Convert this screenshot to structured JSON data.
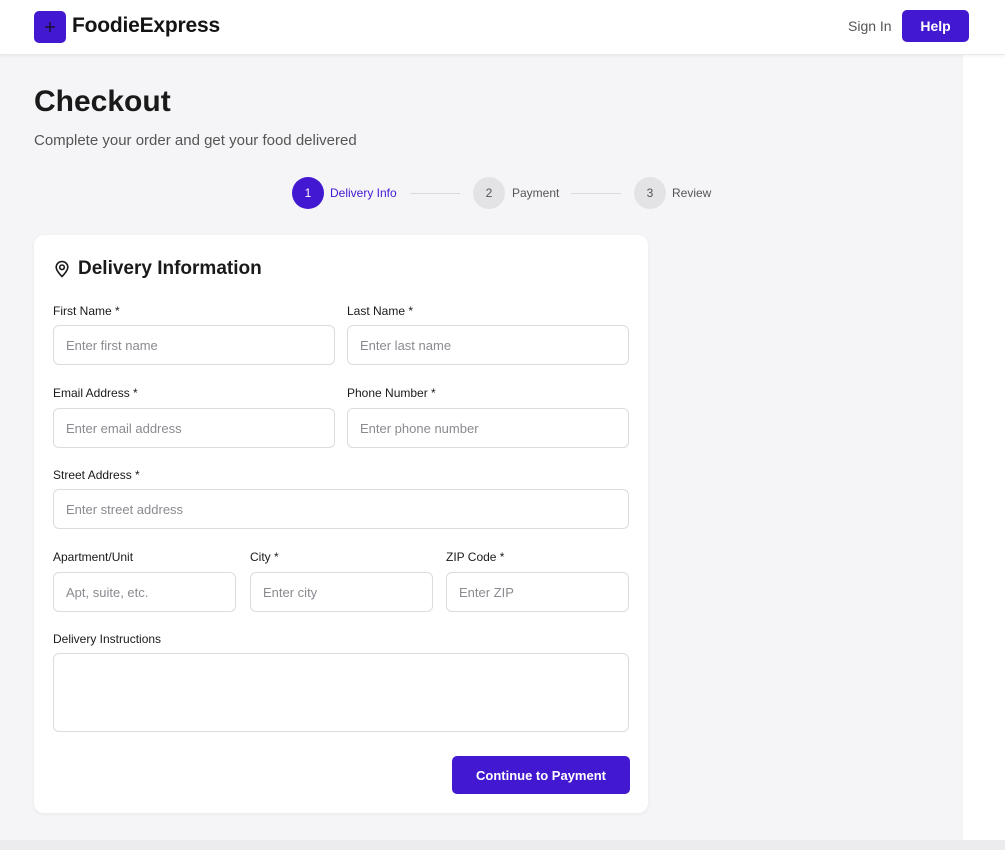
{
  "header": {
    "brand": "FoodieExpress",
    "signin_label": "Sign In",
    "help_label": "Help"
  },
  "page": {
    "title": "Checkout",
    "subtitle": "Complete your order and get your food delivered"
  },
  "steps": [
    {
      "number": "1",
      "label": "Delivery Info",
      "state": "active"
    },
    {
      "number": "2",
      "label": "Payment",
      "state": "inactive"
    },
    {
      "number": "3",
      "label": "Review",
      "state": "inactive"
    }
  ],
  "form": {
    "title": "Delivery Information",
    "first_name": {
      "label": "First Name *",
      "placeholder": "Enter first name",
      "value": ""
    },
    "last_name": {
      "label": "Last Name *",
      "placeholder": "Enter last name",
      "value": ""
    },
    "email": {
      "label": "Email Address *",
      "placeholder": "Enter email address",
      "value": ""
    },
    "phone": {
      "label": "Phone Number *",
      "placeholder": "Enter phone number",
      "value": ""
    },
    "street": {
      "label": "Street Address *",
      "placeholder": "Enter street address",
      "value": ""
    },
    "apartment": {
      "label": "Apartment/Unit",
      "placeholder": "Apt, suite, etc.",
      "value": ""
    },
    "city": {
      "label": "City *",
      "placeholder": "Enter city",
      "value": ""
    },
    "zip": {
      "label": "ZIP Code *",
      "placeholder": "Enter ZIP",
      "value": ""
    },
    "instructions": {
      "label": "Delivery Instructions",
      "value": ""
    },
    "submit_label": "Continue to Payment"
  },
  "colors": {
    "accent": "#4318d1",
    "page_background": "#f5f5f7",
    "card_background": "#ffffff",
    "step_inactive": "#e3e3e6"
  },
  "icons": {
    "logo": "plus-icon",
    "section": "map-pin-icon"
  }
}
